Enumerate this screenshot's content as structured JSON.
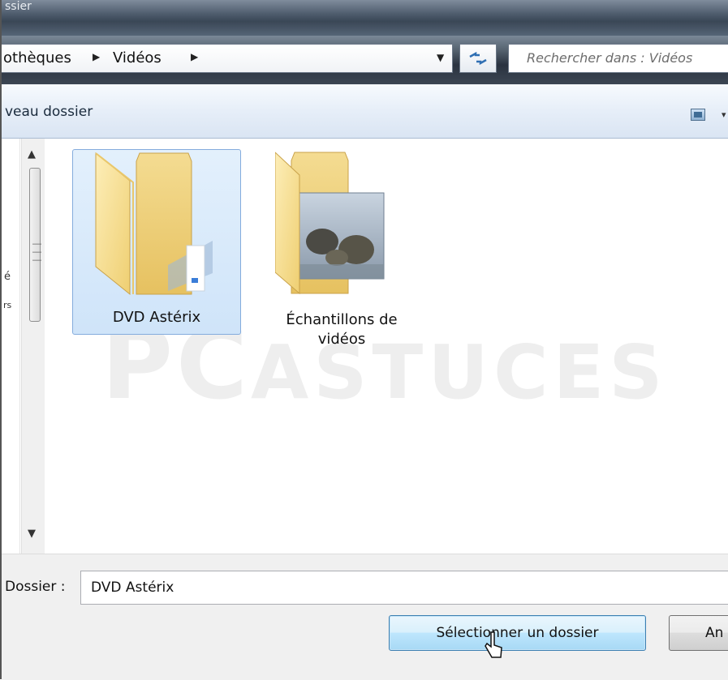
{
  "window": {
    "title_fragment": "ssier"
  },
  "address_bar": {
    "breadcrumbs": [
      "othèques",
      "Vidéos"
    ],
    "search_placeholder": "Rechercher dans : Vidéos"
  },
  "toolbar": {
    "new_folder_label": "veau dossier"
  },
  "nav_pane": {
    "fragments": [
      "é",
      "rs"
    ]
  },
  "folders": [
    {
      "label": "DVD Astérix",
      "selected": true
    },
    {
      "label_line1": "Échantillons de",
      "label_line2": "vidéos",
      "selected": false
    }
  ],
  "watermark": {
    "text_big": "PC",
    "text_small": "ASTUCES"
  },
  "bottom": {
    "folder_label": "Dossier :",
    "folder_value": "DVD Astérix",
    "select_button": "Sélectionner un dossier",
    "cancel_button": "An"
  },
  "colors": {
    "selection_bg": "#cfe4f9",
    "selection_border": "#84acdd",
    "title_bar": "#3a4756"
  }
}
